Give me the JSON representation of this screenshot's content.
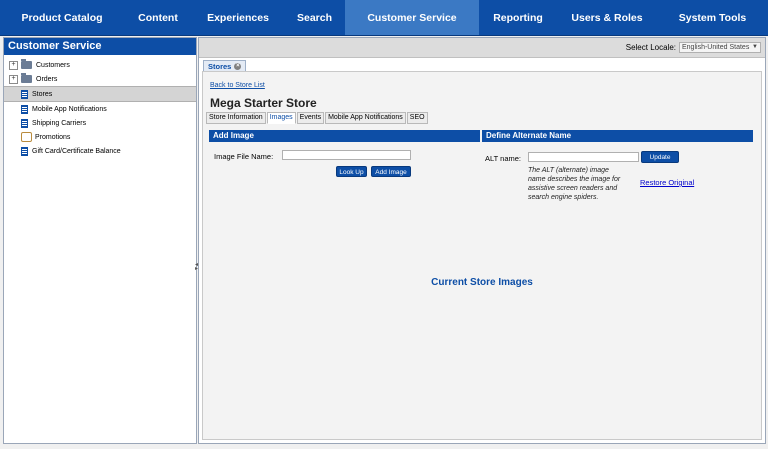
{
  "nav": {
    "items": [
      {
        "label": "Product Catalog"
      },
      {
        "label": "Content"
      },
      {
        "label": "Experiences"
      },
      {
        "label": "Search"
      },
      {
        "label": "Customer Service",
        "active": true
      },
      {
        "label": "Reporting"
      },
      {
        "label": "Users & Roles"
      },
      {
        "label": "System Tools"
      }
    ]
  },
  "sidebar": {
    "title": "Customer Service",
    "items": [
      {
        "label": "Customers",
        "icon": "folder-icon",
        "expandable": true
      },
      {
        "label": "Orders",
        "icon": "folder-icon",
        "expandable": true
      },
      {
        "label": "Stores",
        "icon": "store-icon",
        "selected": true
      },
      {
        "label": "Mobile App Notifications",
        "icon": "mobile-icon"
      },
      {
        "label": "Shipping Carriers",
        "icon": "carrier-icon"
      },
      {
        "label": "Promotions",
        "icon": "promotion-icon"
      },
      {
        "label": "Gift Card/Certificate Balance",
        "icon": "giftcard-icon"
      }
    ]
  },
  "toolbar": {
    "locale_label": "Select Locale:",
    "locale_value": "English-United States"
  },
  "tab": {
    "label": "Stores"
  },
  "content": {
    "back_link": "Back to Store List",
    "store_name": "Mega Starter Store",
    "subtabs": [
      {
        "label": "Store Information"
      },
      {
        "label": "Images",
        "active": true
      },
      {
        "label": "Events"
      },
      {
        "label": "Mobile App Notifications"
      },
      {
        "label": "SEO"
      }
    ],
    "add_image": {
      "header": "Add Image",
      "file_label": "Image File Name:",
      "file_value": "",
      "lookup_button": "Look Up",
      "add_button": "Add Image"
    },
    "alt_name": {
      "header": "Define Alternate Name",
      "alt_label": "ALT name:",
      "alt_value": "",
      "update_button": "Update",
      "help_line1": "The ALT (alternate) image",
      "help_line2": "name describes the image for",
      "help_line3": "assistive screen readers and",
      "help_line4": "search engine spiders.",
      "restore_link": "Restore Original"
    },
    "current_images_title": "Current Store Images"
  },
  "colors": {
    "brand": "#0d4ea6",
    "active_nav": "#3b79c4"
  }
}
